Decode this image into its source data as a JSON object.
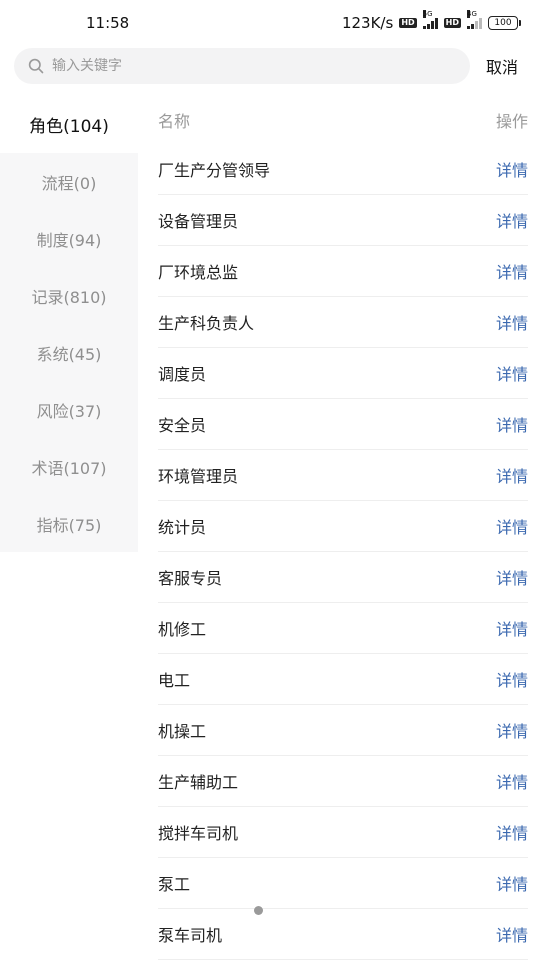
{
  "status_bar": {
    "time": "11:58",
    "speed": "123K/s",
    "hd_label": "HD",
    "gen1": "5G",
    "gen2": "4G",
    "battery": "100"
  },
  "search": {
    "placeholder": "输入关键字",
    "value": "",
    "cancel_label": "取消"
  },
  "sidebar": {
    "items": [
      {
        "label": "角色(104)"
      },
      {
        "label": "流程(0)"
      },
      {
        "label": "制度(94)"
      },
      {
        "label": "记录(810)"
      },
      {
        "label": "系统(45)"
      },
      {
        "label": "风险(37)"
      },
      {
        "label": "术语(107)"
      },
      {
        "label": "指标(75)"
      }
    ]
  },
  "list": {
    "header_name": "名称",
    "header_action": "操作",
    "detail_label": "详情",
    "rows": [
      {
        "name": "厂生产分管领导"
      },
      {
        "name": "设备管理员"
      },
      {
        "name": "厂环境总监"
      },
      {
        "name": "生产科负责人"
      },
      {
        "name": "调度员"
      },
      {
        "name": "安全员"
      },
      {
        "name": "环境管理员"
      },
      {
        "name": "统计员"
      },
      {
        "name": "客服专员"
      },
      {
        "name": "机修工"
      },
      {
        "name": "电工"
      },
      {
        "name": "机操工"
      },
      {
        "name": "生产辅助工"
      },
      {
        "name": "搅拌车司机"
      },
      {
        "name": "泵工"
      },
      {
        "name": "泵车司机"
      }
    ]
  },
  "colors": {
    "accent": "#3d6ab0",
    "sidebar_bg": "#f7f7f8",
    "search_bg": "#f3f3f4"
  }
}
